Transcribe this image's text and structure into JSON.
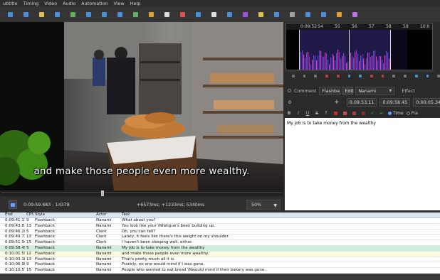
{
  "menu": [
    "ubtitle",
    "Timing",
    "Video",
    "Audio",
    "Automation",
    "View",
    "Help"
  ],
  "toolbar_icons": [
    {
      "name": "open-icon",
      "color": "#4a90d9"
    },
    {
      "name": "save-icon",
      "color": "#4a90d9"
    },
    {
      "name": "properties-icon",
      "color": "#e0c050"
    },
    {
      "name": "attachments-icon",
      "color": "#4a90d9"
    },
    {
      "name": "fonts-icon",
      "color": "#60b060"
    },
    {
      "name": "video-jump-icon",
      "color": "#4a90d9"
    },
    {
      "name": "jump-start-icon",
      "color": "#4a90d9"
    },
    {
      "name": "jump-end-icon",
      "color": "#4a90d9"
    },
    {
      "name": "find-icon",
      "color": "#60b060"
    },
    {
      "name": "replace-icon",
      "color": "#e0a030"
    },
    {
      "name": "shift-times-icon",
      "color": "#dddddd"
    },
    {
      "name": "styles-manager-icon",
      "color": "#e05050"
    },
    {
      "name": "styling-assistant-icon",
      "color": "#4a90d9"
    },
    {
      "name": "translation-assistant-icon",
      "color": "#dddddd"
    },
    {
      "name": "resample-icon",
      "color": "#4a90d9"
    },
    {
      "name": "timing-postprocessor-icon",
      "color": "#a050e0"
    },
    {
      "name": "kanji-timer-icon",
      "color": "#e0c050"
    },
    {
      "name": "spell-check-icon",
      "color": "#4a90d9"
    },
    {
      "name": "options-icon",
      "color": "#a0a0a0"
    },
    {
      "name": "macro-icon",
      "color": "#4a90d9"
    },
    {
      "name": "automation-icon",
      "color": "#4a90d9"
    },
    {
      "name": "detach-video-icon",
      "color": "#e0a030"
    },
    {
      "name": "about-icon",
      "color": "#c070e0"
    }
  ],
  "video": {
    "subtitle_text": "and make those people even more wealthy.",
    "position": "0:09:59.683 - 14378",
    "offset": "+6573ms; +1233ms; 5340ms",
    "zoom": "50%",
    "seek_fraction": 0.355
  },
  "audio": {
    "ruler": [
      "0:09:52",
      "54",
      "55",
      "56",
      "57",
      "58",
      "59",
      "10:0"
    ]
  },
  "edit": {
    "comment_label": "Comment",
    "style_value": "Flashba",
    "edit_label": "Edit",
    "actor_value": "Nanami",
    "effect_label": "Effect",
    "layer": "0",
    "start_time": "0:09:53.11",
    "end_time": "0:09:58.45",
    "duration": "0:00:05.34",
    "time_label": "Time",
    "frame_label": "Fra",
    "line_text": "My job is to take money from the wealthy"
  },
  "grid": {
    "columns": [
      "End",
      "CPS",
      "Style",
      "Actor",
      "Text"
    ],
    "rows": [
      {
        "end": "0:09:41.11",
        "cps": "9",
        "style": "Flashback",
        "actor": "Nanami",
        "text": "What about you?",
        "bg": "#ffffff"
      },
      {
        "end": "0:09:43.81",
        "cps": "13",
        "style": "Flashback",
        "actor": "Nanami",
        "text": "You look like your \\Nfatigue's been building up.",
        "bg": "#ffffff"
      },
      {
        "end": "0:09:46.28",
        "cps": "5",
        "style": "Flashback",
        "actor": "Clerk",
        "text": "Oh, you can tell?",
        "bg": "#ffffff"
      },
      {
        "end": "0:09:49.73",
        "cps": "13",
        "style": "Flashback",
        "actor": "Clerk",
        "text": "Lately, it feels like there's this weight on my shoulder.",
        "bg": "#ffffff"
      },
      {
        "end": "0:09:51.94",
        "cps": "15",
        "style": "Flashback",
        "actor": "Clerk",
        "text": "I haven't been sleeping well, either.",
        "bg": "#ffffff"
      },
      {
        "end": "0:09:58.45",
        "cps": "5",
        "style": "Flashback",
        "actor": "Nanami",
        "text": "My job is to take money from the wealthy",
        "bg": "#cfeedd"
      },
      {
        "end": "0:10:01.55",
        "cps": "12",
        "style": "Flashback",
        "actor": "Nanami",
        "text": "and make those people even more wealthy.",
        "bg": "#fffbe0"
      },
      {
        "end": "0:10:03.18",
        "cps": "13",
        "style": "Flashback",
        "actor": "Nanami",
        "text": "That's pretty much all it is.",
        "bg": "#ffffff"
      },
      {
        "end": "0:10:06.98",
        "cps": "9",
        "style": "Flashback",
        "actor": "Nanami",
        "text": "Frankly, no one would mind if I was gone.",
        "bg": "#ffffff"
      },
      {
        "end": "0:10:10.57",
        "cps": "15",
        "style": "Flashback",
        "actor": "Nanami",
        "text": "People who wanted to eat bread \\Nwould mind if their bakery was gone.",
        "bg": "#ffffff"
      }
    ]
  }
}
